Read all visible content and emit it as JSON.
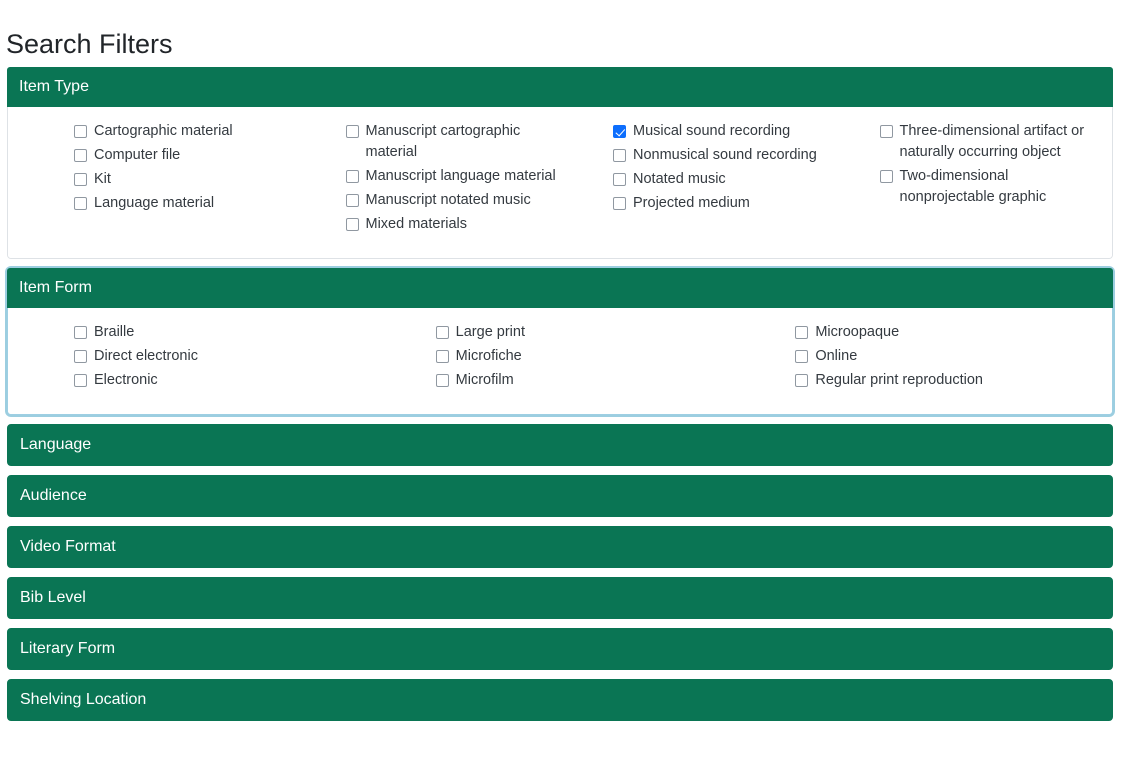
{
  "page": {
    "title": "Search Filters"
  },
  "colors": {
    "header_green": "#0a7554",
    "checked_blue": "#0d6efd",
    "focus_ring": "#8bc5db",
    "card_border": "#dee2e6",
    "text": "#212529"
  },
  "sections": [
    {
      "id": "item-type",
      "title": "Item Type",
      "expanded": true,
      "focused": false,
      "columns": [
        [
          {
            "label": "Cartographic material",
            "checked": false
          },
          {
            "label": "Computer file",
            "checked": false
          },
          {
            "label": "Kit",
            "checked": false
          },
          {
            "label": "Language material",
            "checked": false
          }
        ],
        [
          {
            "label": "Manuscript cartographic material",
            "checked": false
          },
          {
            "label": "Manuscript language material",
            "checked": false
          },
          {
            "label": "Manuscript notated music",
            "checked": false
          },
          {
            "label": "Mixed materials",
            "checked": false
          }
        ],
        [
          {
            "label": "Musical sound recording",
            "checked": true
          },
          {
            "label": "Nonmusical sound recording",
            "checked": false
          },
          {
            "label": "Notated music",
            "checked": false
          },
          {
            "label": "Projected medium",
            "checked": false
          }
        ],
        [
          {
            "label": "Three-dimensional artifact or naturally occurring object",
            "checked": false
          },
          {
            "label": "Two-dimensional nonprojectable graphic",
            "checked": false
          }
        ]
      ]
    },
    {
      "id": "item-form",
      "title": "Item Form",
      "expanded": true,
      "focused": true,
      "columns": [
        [
          {
            "label": "Braille",
            "checked": false
          },
          {
            "label": "Direct electronic",
            "checked": false
          },
          {
            "label": "Electronic",
            "checked": false
          }
        ],
        [
          {
            "label": "Large print",
            "checked": false
          },
          {
            "label": "Microfiche",
            "checked": false
          },
          {
            "label": "Microfilm",
            "checked": false
          }
        ],
        [
          {
            "label": "Microopaque",
            "checked": false
          },
          {
            "label": "Online",
            "checked": false
          },
          {
            "label": "Regular print reproduction",
            "checked": false
          }
        ]
      ]
    }
  ],
  "collapsed_sections": [
    {
      "id": "language",
      "title": "Language"
    },
    {
      "id": "audience",
      "title": "Audience"
    },
    {
      "id": "video-format",
      "title": "Video Format"
    },
    {
      "id": "bib-level",
      "title": "Bib Level"
    },
    {
      "id": "literary-form",
      "title": "Literary Form"
    },
    {
      "id": "shelving-location",
      "title": "Shelving Location"
    }
  ]
}
